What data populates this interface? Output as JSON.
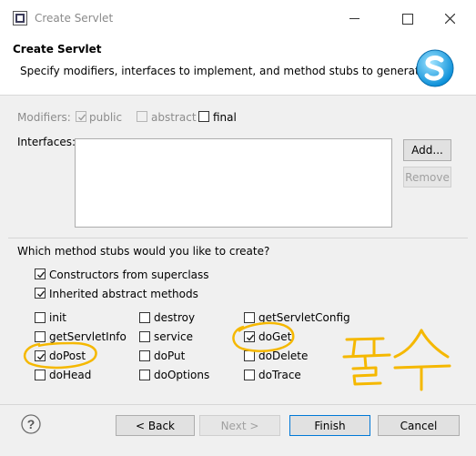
{
  "window": {
    "title": "Create Servlet"
  },
  "header": {
    "title": "Create Servlet",
    "subtitle": "Specify modifiers, interfaces to implement, and method stubs to generate."
  },
  "modifiers": {
    "label": "Modifiers:",
    "public": {
      "label": "public",
      "checked": true,
      "enabled": false
    },
    "abstract": {
      "label": "abstract",
      "checked": false,
      "enabled": false
    },
    "final": {
      "label": "final",
      "checked": false,
      "enabled": true
    }
  },
  "interfaces": {
    "label": "Interfaces:",
    "items": []
  },
  "buttons": {
    "add": "Add...",
    "remove": "Remove",
    "back": "< Back",
    "next": "Next >",
    "finish": "Finish",
    "cancel": "Cancel"
  },
  "stubs": {
    "question": "Which method stubs would you like to create?",
    "constructors": "Constructors from superclass",
    "inherited": "Inherited abstract methods",
    "init": "init",
    "destroy": "destroy",
    "getServletConfig": "getServletConfig",
    "getServletInfo": "getServletInfo",
    "service": "service",
    "doGet": "doGet",
    "doPost": "doPost",
    "doPut": "doPut",
    "doDelete": "doDelete",
    "doHead": "doHead",
    "doOptions": "doOptions",
    "doTrace": "doTrace"
  },
  "annotation": {
    "text": "필수",
    "color": "#f5b800"
  },
  "colors": {
    "accent": "#0078d7"
  }
}
